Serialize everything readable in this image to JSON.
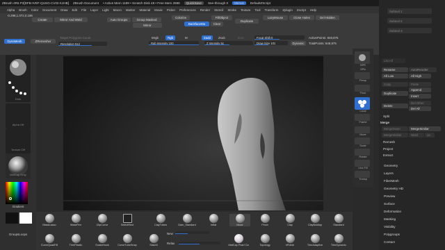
{
  "titlebar": {
    "app": "ZBrush 4R6 P2[DFB-IVEF-QUSG-CVGI-KJHB]",
    "doc": "ZBrush Document",
    "active": "• Active Mem 1189 • Scratch Disk 48 • Free Mem 2988",
    "quicksave": "QuickSave",
    "seethrough": "See-through 0",
    "menus": "Menus",
    "script": "DefaultZScript"
  },
  "menubar": [
    "Alpha",
    "Brush",
    "Color",
    "Document",
    "Draw",
    "Edit",
    "File",
    "Layer",
    "Light",
    "Macro",
    "Marker",
    "Material",
    "Movie",
    "Picker",
    "Preferences",
    "Render",
    "Stencil",
    "Stroke",
    "Texture",
    "Tool",
    "Transform",
    "Zplugin",
    "Zscript",
    "Help"
  ],
  "coords": "-0.298,1.072,0.186",
  "toolbar": {
    "dynamesh": "DynaMesh",
    "zremesher": "ZRemesher",
    "target_poly": "Target Polygons Count",
    "resolution": "Resolution 512",
    "create": "Create",
    "mirror_weld": "Mirror And Weld",
    "auto_groups": "Auto Groups",
    "group_masked": "Group Masked",
    "mirror": "Mirror",
    "colorize": "Colorize",
    "backface": "BackfaceMa",
    "clear": "Clear",
    "fill_object": "FillObject",
    "duplicate": "Duplicate",
    "lazymouse": "LazyMouse",
    "close_holes": "Close Holes",
    "del_hidden": "Del Hidden",
    "rgb": "Rgb",
    "mrgb": "Mrgb",
    "m": "M",
    "rgb_intensity": "Rgb Intensity 100",
    "zadd": "Zadd",
    "zsub": "Zsub",
    "zcut": "Zcut",
    "z_intensity": "Z Intensity 51",
    "focal_shift": "Focal Shift 0",
    "draw_size": "Draw Size 101",
    "dynamic": "Dynamic",
    "active_points": "ActivePoints: 848,875",
    "total_points": "TotalPoints: 848,875"
  },
  "leftshelf": {
    "thumbs": [
      "Move",
      "Dots",
      "Alpha Off",
      "Texture Off",
      "MatCap Gray"
    ],
    "gradient": "Gradient",
    "groups": "GroupsLoops"
  },
  "rightcol": [
    "BPR",
    "SPix",
    "Persp",
    "Floor",
    "Local",
    "Frame",
    "Move",
    "Scale",
    "Rotate",
    "Line Fill",
    "PolyF",
    "Transp",
    "Solo",
    "Ghost",
    "Xpose"
  ],
  "panel": {
    "subtools": [
      "Subtool 1",
      "Subtool 2",
      "Subtool 3"
    ],
    "list_all": "List All",
    "rename": "Rename",
    "autoreorder": "AutoReorder",
    "all_low": "All Low",
    "all_high": "All High",
    "copy": "Copy",
    "paste": "Paste",
    "append": "Append",
    "duplicate": "Duplicate",
    "insert": "Insert",
    "delete": "Delete",
    "del_other": "Del Other",
    "del_all": "Del All",
    "split": "Split",
    "merge": "Merge",
    "merge_down": "MergeDown",
    "merge_similar": "MergeSimilar",
    "merge_visible": "MergeVisible",
    "weld": "Weld",
    "uv": "Uv",
    "remesh": "Remesh",
    "project": "Project",
    "extract": "Extract",
    "sections": [
      "Geometry",
      "Layers",
      "FiberMesh",
      "Geometry HD",
      "Preview",
      "Surface",
      "Deformation",
      "Masking",
      "Visibility",
      "Polygroups",
      "Contact"
    ]
  },
  "brushes_row1": [
    "MaskLasso",
    "MaskPen",
    "ClipCurve",
    "SelectRect",
    "ClayTubes",
    "Dam_Standard",
    "Inflat",
    "Move",
    "Pinch",
    "Clay",
    "ClayBuildup",
    "Standard"
  ],
  "brushes_row2": [
    "CurveQuadFill",
    "TrimPlastic",
    "SnakeHook",
    "CurveTubeSnap",
    "Slash3",
    "",
    "MatCap Pearl Ca",
    "Topology",
    "hPolish",
    "TrimAdaptive",
    "TrimDynamic"
  ],
  "bottom": {
    "new": "New",
    "relax": "Relax"
  },
  "colors": {
    "accent": "#2e6fd0"
  }
}
